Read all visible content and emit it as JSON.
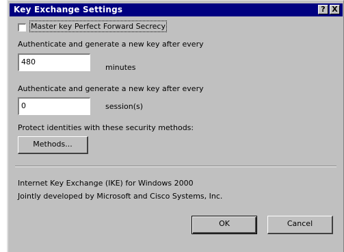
{
  "window": {
    "title": "Key Exchange Settings",
    "help_glyph": "?",
    "close_glyph": "X"
  },
  "master_key_pfs": {
    "label": "Master key Perfect Forward Secrecy",
    "checked": false
  },
  "auth_minutes": {
    "label": "Authenticate and generate a new key after every",
    "value": "480",
    "unit": "minutes"
  },
  "auth_sessions": {
    "label": "Authenticate and generate a new key after every",
    "value": "0",
    "unit": "session(s)"
  },
  "protect_identities": {
    "label": "Protect identities with these security methods:",
    "methods_button": "Methods..."
  },
  "footer": {
    "line1": "Internet Key Exchange (IKE) for Windows 2000",
    "line2": "Jointly developed by Microsoft and Cisco Systems, Inc."
  },
  "buttons": {
    "ok": "OK",
    "cancel": "Cancel"
  }
}
